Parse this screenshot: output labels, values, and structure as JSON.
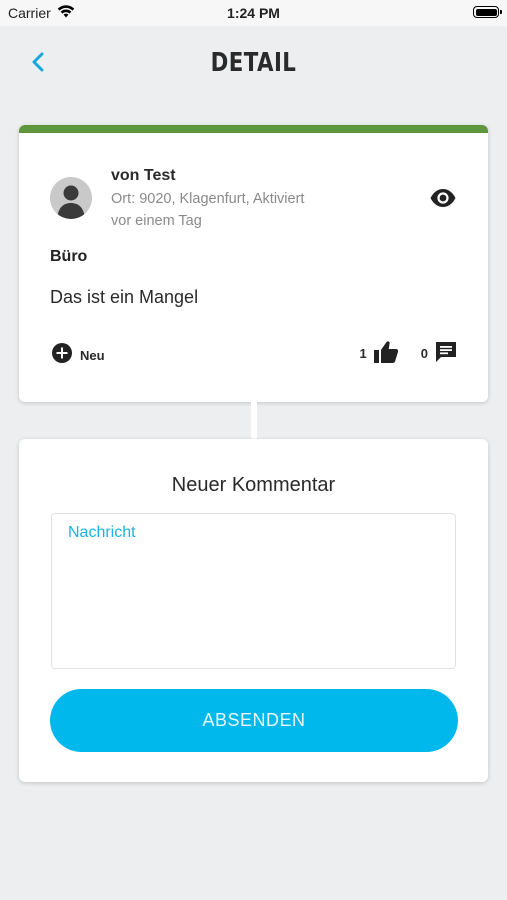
{
  "status_bar": {
    "carrier": "Carrier",
    "time": "1:24 PM"
  },
  "header": {
    "title": "DETAIL"
  },
  "report": {
    "author": "von Test",
    "location": "Ort: 9020, Klagenfurt, Aktiviert",
    "time_ago": "vor einem Tag",
    "category": "Büro",
    "description": "Das ist ein Mangel",
    "status_label": "Neu",
    "like_count": "1",
    "comment_count": "0",
    "status_color": "#5e963c"
  },
  "comment_form": {
    "title": "Neuer Kommentar",
    "message_placeholder": "Nachricht",
    "submit_label": "ABSENDEN",
    "accent_color": "#00b8ec"
  },
  "icons": {
    "back": "chevron-left-icon",
    "wifi": "wifi-icon",
    "battery": "battery-icon",
    "avatar": "user-avatar-icon",
    "visibility": "eye-icon",
    "status": "plus-circle-icon",
    "like": "thumbs-up-icon",
    "comment": "comment-icon"
  }
}
